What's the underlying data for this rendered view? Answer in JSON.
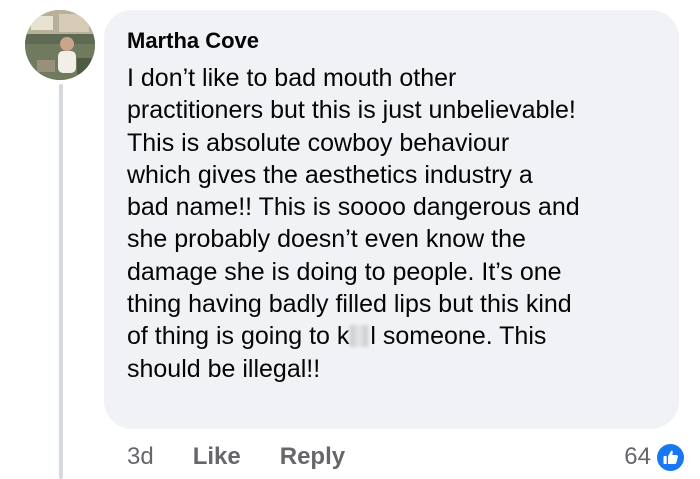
{
  "comment": {
    "author": "Martha Cove",
    "lines": {
      "l1": "I don’t like to bad mouth other",
      "l2": "practitioners but this is just unbelievable!",
      "l3": "This is absolute cowboy behaviour",
      "l4": "which gives the aesthetics industry a",
      "l5": "bad name!! This is soooo dangerous and",
      "l6": "she probably doesn’t even know the",
      "l7": "damage she is doing to people. It’s one",
      "l8": "thing having badly filled lips but this kind",
      "l9a": "of thing is going to k",
      "l9b": "l someone. This",
      "l10": "should be illegal!!"
    }
  },
  "actions": {
    "time": "3d",
    "like": "Like",
    "reply": "Reply"
  },
  "reactions": {
    "count": "64",
    "icon": "like-icon",
    "color": "#1877f2"
  }
}
